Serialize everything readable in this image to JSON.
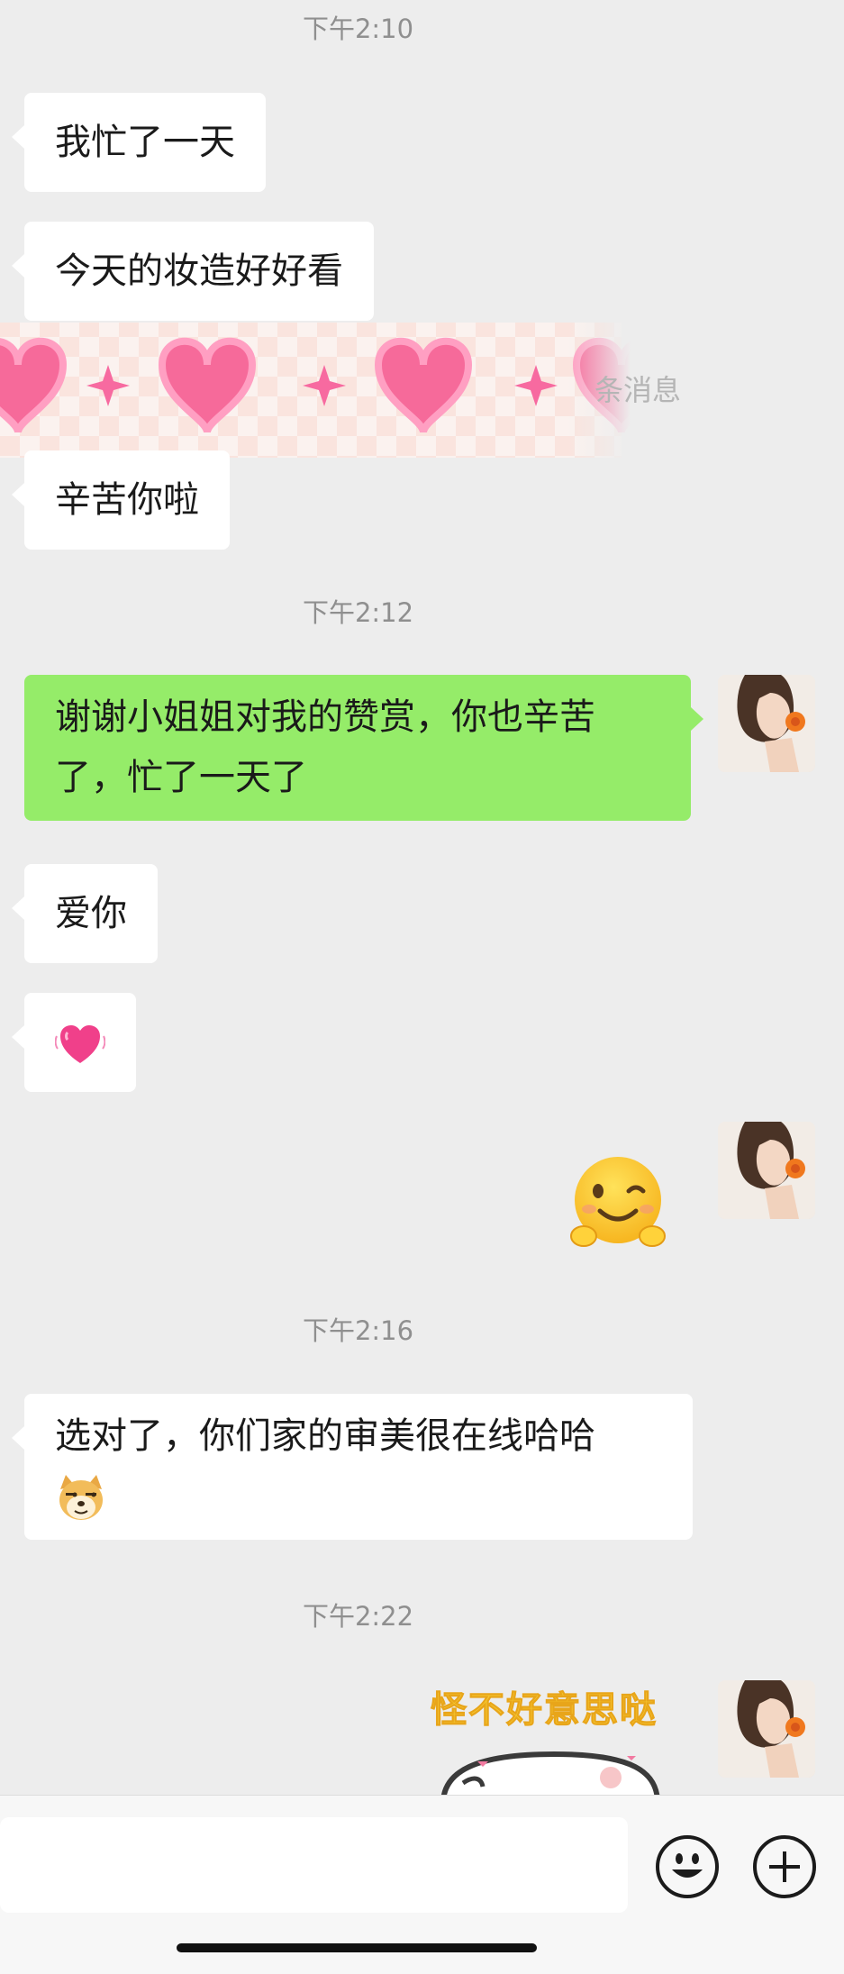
{
  "timestamps": [
    "下午2:10",
    "下午2:12",
    "下午2:16",
    "下午2:22"
  ],
  "messages": {
    "m1": "我忙了一天",
    "m2": "今天的妆造好好看",
    "overlay_suffix": "条消息",
    "m3": "辛苦你啦",
    "m4": "谢谢小姐姐对我的赞赏，你也辛苦了，忙了一天了",
    "m5": "爱你",
    "m7": "选对了，你们家的审美很在线哈哈"
  },
  "sticker": {
    "caption": "怪不好意思哒"
  },
  "colors": {
    "background": "#EDEDED",
    "bubble_incoming": "#FFFFFF",
    "bubble_outgoing": "#95EC69"
  },
  "icons": {
    "heart_emoji": "beating-heart",
    "wink_emoji": "wink-smile",
    "doge_emoji": "doge",
    "emoji_button": "smiley-face",
    "plus_button": "plus-circle"
  }
}
